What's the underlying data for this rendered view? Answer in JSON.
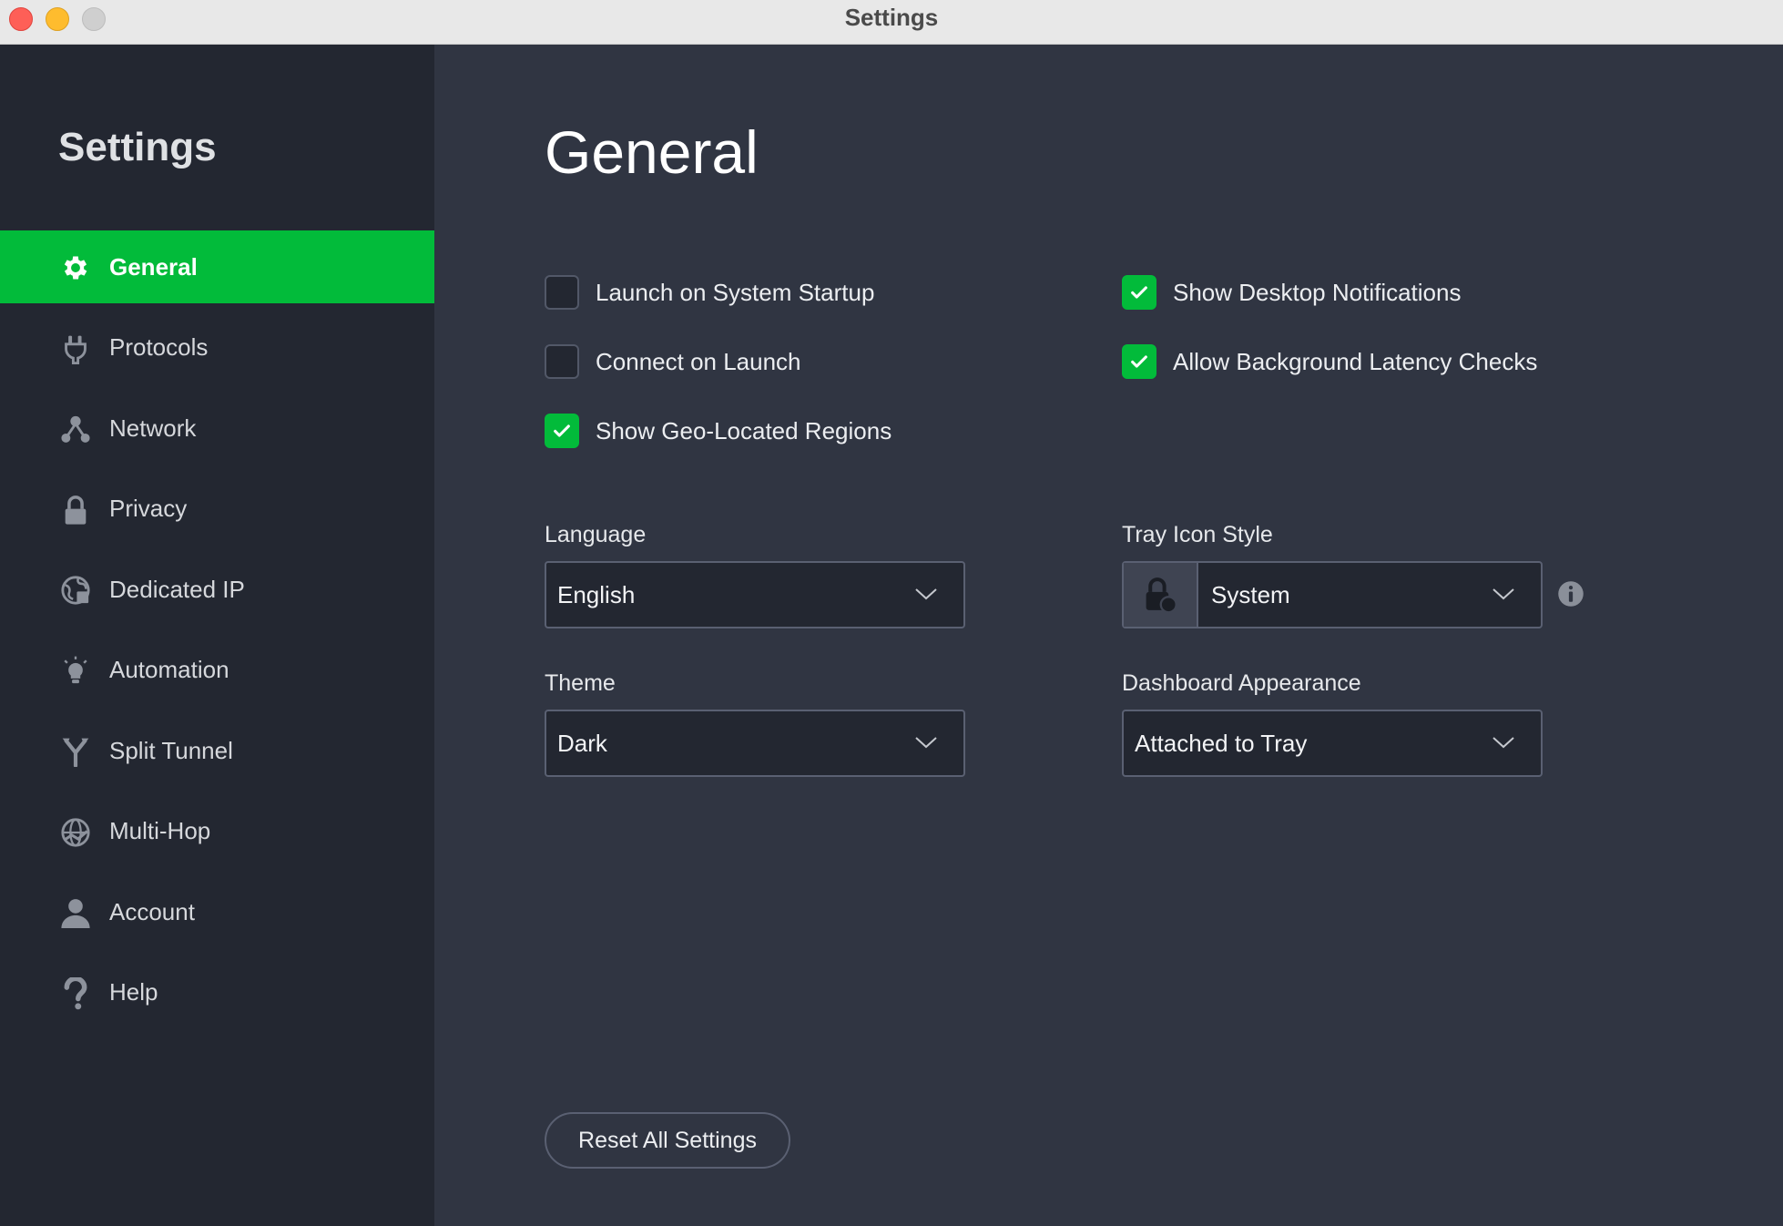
{
  "window": {
    "title": "Settings"
  },
  "sidebar": {
    "title": "Settings",
    "items": [
      {
        "label": "General",
        "icon": "gear-icon",
        "active": true
      },
      {
        "label": "Protocols",
        "icon": "plug-icon"
      },
      {
        "label": "Network",
        "icon": "network-icon"
      },
      {
        "label": "Privacy",
        "icon": "lock-icon"
      },
      {
        "label": "Dedicated IP",
        "icon": "globe-ip-icon"
      },
      {
        "label": "Automation",
        "icon": "lightbulb-icon"
      },
      {
        "label": "Split Tunnel",
        "icon": "split-icon"
      },
      {
        "label": "Multi-Hop",
        "icon": "multi-hop-globe-icon"
      },
      {
        "label": "Account",
        "icon": "user-icon"
      },
      {
        "label": "Help",
        "icon": "question-icon"
      }
    ]
  },
  "main": {
    "title": "General",
    "checkboxes": [
      {
        "label": "Launch on System Startup",
        "checked": false
      },
      {
        "label": "Connect on Launch",
        "checked": false
      },
      {
        "label": "Show Geo-Located Regions",
        "checked": true
      },
      {
        "label": "Show Desktop Notifications",
        "checked": true
      },
      {
        "label": "Allow Background Latency Checks",
        "checked": true
      }
    ],
    "language": {
      "label": "Language",
      "value": "English"
    },
    "tray_icon_style": {
      "label": "Tray Icon Style",
      "value": "System"
    },
    "theme": {
      "label": "Theme",
      "value": "Dark"
    },
    "dashboard_appearance": {
      "label": "Dashboard Appearance",
      "value": "Attached to Tray"
    },
    "reset_label": "Reset All Settings"
  },
  "colors": {
    "accent": "#02bb3a",
    "sidebar_bg": "#232731",
    "main_bg": "#303542"
  }
}
